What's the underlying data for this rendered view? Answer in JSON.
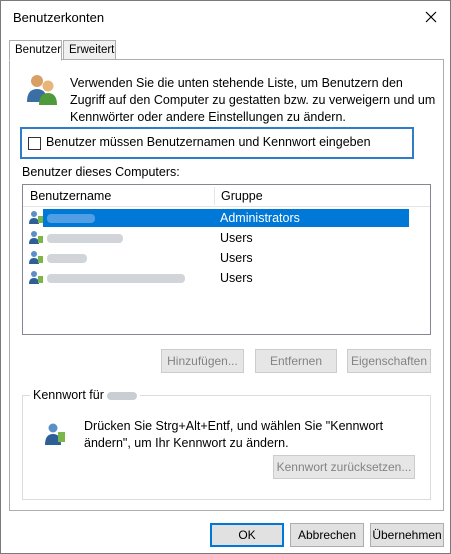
{
  "window": {
    "title": "Benutzerkonten",
    "close_label": "✕"
  },
  "tabs": [
    {
      "label": "Benutzer",
      "active": true
    },
    {
      "label": "Erweitert",
      "active": false
    }
  ],
  "intro_text": "Verwenden Sie die unten stehende Liste, um Benutzern den Zugriff auf den Computer zu gestatten bzw. zu verweigern und um Kennwörter oder andere Einstellungen zu ändern.",
  "require_login": {
    "label": "Benutzer müssen Benutzernamen und Kennwort eingeben",
    "checked": false
  },
  "users_list": {
    "caption": "Benutzer dieses Computers:",
    "columns": [
      "Benutzername",
      "Gruppe"
    ],
    "rows": [
      {
        "group": "Administrators",
        "selected": true
      },
      {
        "group": "Users",
        "selected": false
      },
      {
        "group": "Users",
        "selected": false
      },
      {
        "group": "Users",
        "selected": false
      }
    ]
  },
  "list_buttons": {
    "add": "Hinzufügen...",
    "remove": "Entfernen",
    "properties": "Eigenschaften"
  },
  "password_group": {
    "title": "Kennwort für",
    "text": "Drücken Sie Strg+Alt+Entf, und wählen Sie \"Kennwort ändern\", um Ihr Kennwort zu ändern.",
    "reset_button": "Kennwort zurücksetzen..."
  },
  "dialog_buttons": {
    "ok": "OK",
    "cancel": "Abbrechen",
    "apply": "Übernehmen"
  },
  "colors": {
    "selection": "#0078d7",
    "focus_frame": "#2f7dc8"
  }
}
